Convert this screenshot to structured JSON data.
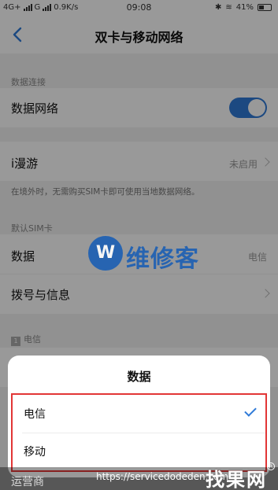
{
  "status_bar": {
    "network_left": "4G+",
    "network_right": "G",
    "speed": "0.9K/s",
    "time": "09:08",
    "battery": "41%"
  },
  "nav": {
    "title": "双卡与移动网络"
  },
  "sections": {
    "data_connection_label": "数据连接",
    "data_network_label": "数据网络",
    "roaming_label": "i漫游",
    "roaming_value": "未启用",
    "roaming_note": "在境外时，无需购买SIM卡即可使用当地数据网络。",
    "default_sim_label": "默认SIM卡",
    "data_label": "数据",
    "data_value": "电信",
    "dial_label": "拨号与信息",
    "sim1_badge": "1",
    "sim1_label": "电信",
    "operator_label": "运营商"
  },
  "data_network_enabled": true,
  "sheet": {
    "title": "数据",
    "options": [
      {
        "label": "电信",
        "selected": true
      },
      {
        "label": "移动",
        "selected": false
      }
    ]
  },
  "watermark": {
    "logo_letter": "W",
    "text": "维修客",
    "url": "https://servicedodeden.com",
    "brand": "找果网",
    "brand_mark": "R"
  },
  "colors": {
    "accent": "#2f7ad8",
    "highlight_box": "#e23636",
    "watermark_blue": "#1b5fb4"
  }
}
